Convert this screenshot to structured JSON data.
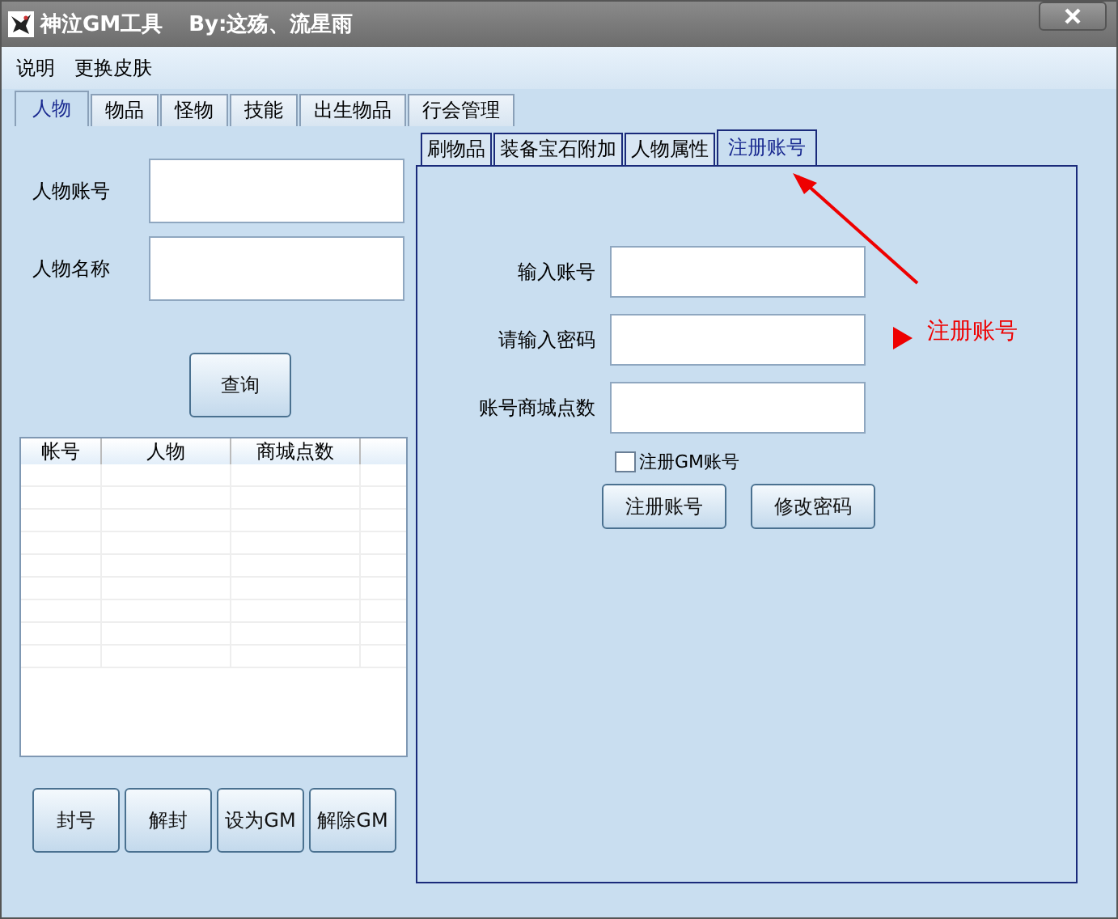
{
  "window": {
    "title": "神泣GM工具",
    "author": "By:这殇、流星雨"
  },
  "menu": [
    "说明",
    "更换皮肤"
  ],
  "tabs": [
    {
      "label": "人物",
      "selected": true
    },
    {
      "label": "物品",
      "selected": false
    },
    {
      "label": "怪物",
      "selected": false
    },
    {
      "label": "技能",
      "selected": false
    },
    {
      "label": "出生物品",
      "selected": false
    },
    {
      "label": "行会管理",
      "selected": false
    }
  ],
  "character_search": {
    "fields": [
      {
        "label": "人物账号"
      },
      {
        "label": "人物名称"
      }
    ],
    "button": "查询"
  },
  "table": {
    "columns": [
      "帐号",
      "人物",
      "商城点数"
    ]
  },
  "account_buttons": [
    "封号",
    "解封",
    "设为GM",
    "解除GM"
  ],
  "inner_tabs": [
    {
      "label": "刷物品",
      "selected": false
    },
    {
      "label": "装备宝石附加",
      "selected": false
    },
    {
      "label": "人物属性",
      "selected": false
    },
    {
      "label": "注册账号",
      "selected": true
    }
  ],
  "register_form": {
    "fields": [
      {
        "label": "输入账号"
      },
      {
        "label": "请输入密码"
      },
      {
        "label": "账号商城点数"
      }
    ],
    "checkbox": {
      "label": "注册GM账号",
      "checked": false
    },
    "buttons": [
      "注册账号",
      "修改密码"
    ]
  },
  "annotation": {
    "text": "注册账号"
  }
}
